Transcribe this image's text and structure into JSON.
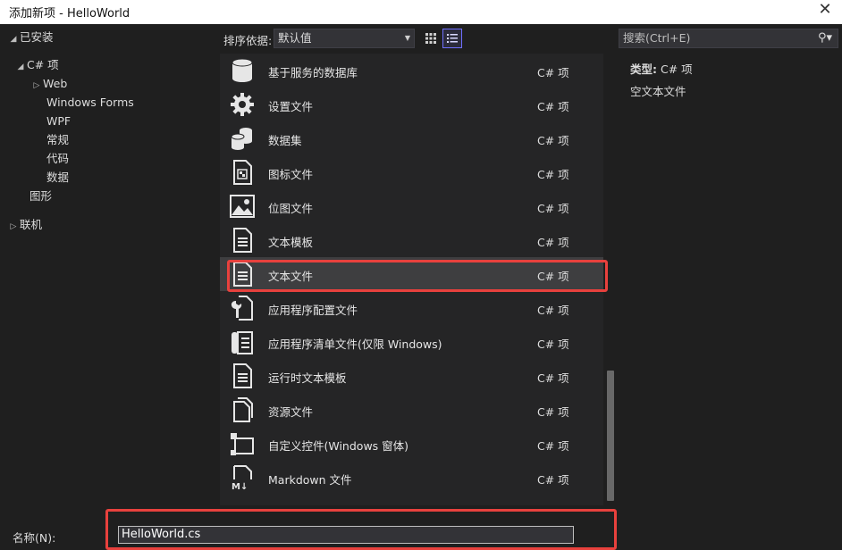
{
  "window": {
    "title": "添加新项 - HelloWorld",
    "close_glyph": "✕"
  },
  "tree": {
    "installed": "已安装",
    "csharp": "C# 项",
    "web": "Web",
    "winforms": "Windows Forms",
    "wpf": "WPF",
    "general": "常规",
    "code": "代码",
    "data": "数据",
    "graphics": "图形",
    "online": "联机"
  },
  "toolbar": {
    "sort_label": "排序依据:",
    "sort_value": "默认值",
    "grid_view": "grid-view-icon",
    "list_view": "list-view-icon"
  },
  "search": {
    "placeholder": "搜索(Ctrl+E)"
  },
  "items": [
    {
      "name": "基于服务的数据库",
      "lang": "C# 项",
      "icon": "database-icon"
    },
    {
      "name": "设置文件",
      "lang": "C# 项",
      "icon": "gear-icon"
    },
    {
      "name": "数据集",
      "lang": "C# 项",
      "icon": "dataset-icon"
    },
    {
      "name": "图标文件",
      "lang": "C# 项",
      "icon": "icon-file-icon"
    },
    {
      "name": "位图文件",
      "lang": "C# 项",
      "icon": "bitmap-icon"
    },
    {
      "name": "文本模板",
      "lang": "C# 项",
      "icon": "text-template-icon"
    },
    {
      "name": "文本文件",
      "lang": "C# 项",
      "icon": "text-file-icon",
      "selected": true
    },
    {
      "name": "应用程序配置文件",
      "lang": "C# 项",
      "icon": "config-file-icon"
    },
    {
      "name": "应用程序清单文件(仅限 Windows)",
      "lang": "C# 项",
      "icon": "manifest-icon"
    },
    {
      "name": "运行时文本模板",
      "lang": "C# 项",
      "icon": "runtime-template-icon"
    },
    {
      "name": "资源文件",
      "lang": "C# 项",
      "icon": "resource-file-icon"
    },
    {
      "name": "自定义控件(Windows 窗体)",
      "lang": "C# 项",
      "icon": "custom-control-icon"
    },
    {
      "name": "Markdown 文件",
      "lang": "C# 项",
      "icon": "markdown-icon"
    }
  ],
  "details": {
    "type_label": "类型:",
    "type_value": "C# 项",
    "description": "空文本文件"
  },
  "bottom": {
    "name_label": "名称(N):",
    "name_value": "HelloWorld.cs"
  },
  "colors": {
    "highlight": "#e8413d",
    "selected_row": "#3e3e40"
  }
}
